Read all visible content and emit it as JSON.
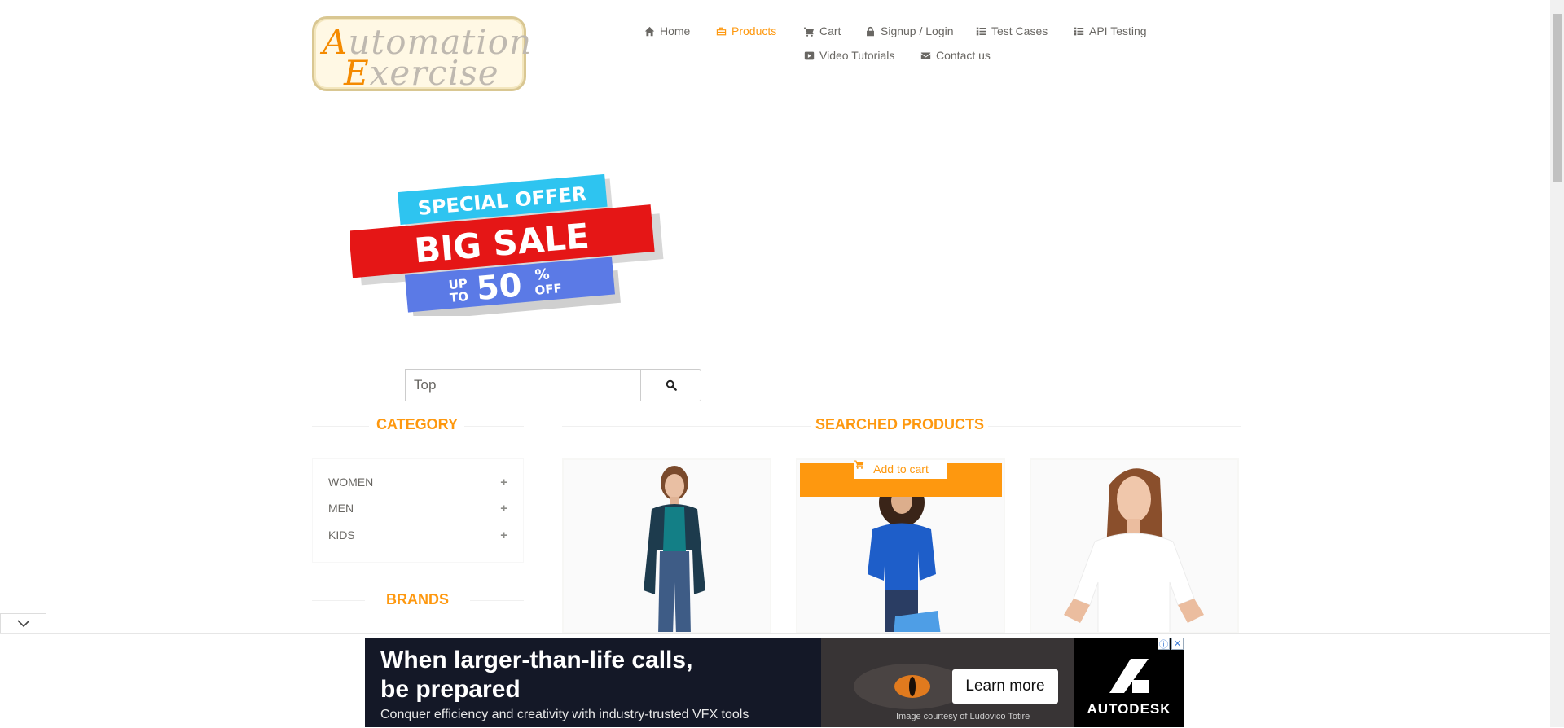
{
  "logo": {
    "line1_cap": "A",
    "line1_rest": "utomation",
    "line2_cap": "E",
    "line2_rest": "xercise"
  },
  "nav": {
    "items": [
      {
        "label": "Home",
        "icon": "home-icon"
      },
      {
        "label": "Products",
        "icon": "products-icon",
        "active": true
      },
      {
        "label": "Cart",
        "icon": "cart-icon"
      },
      {
        "label": "Signup / Login",
        "icon": "lock-icon"
      },
      {
        "label": "Test Cases",
        "icon": "list-icon"
      },
      {
        "label": "API Testing",
        "icon": "list-icon"
      },
      {
        "label": "Video Tutorials",
        "icon": "youtube-icon"
      },
      {
        "label": "Contact us",
        "icon": "envelope-icon"
      }
    ]
  },
  "banner": {
    "line1": "SPECIAL OFFER",
    "line2": "BIG SALE",
    "line3_up": "UP",
    "line3_to": "TO",
    "line3_pct": "50",
    "line3_sym": "%",
    "line3_off": "OFF"
  },
  "search": {
    "value": "Top"
  },
  "sidebar": {
    "category_title": "CATEGORY",
    "categories": [
      {
        "label": "WOMEN",
        "toggle": "+"
      },
      {
        "label": "MEN",
        "toggle": "+"
      },
      {
        "label": "KIDS",
        "toggle": "+"
      }
    ],
    "brands_title": "BRANDS"
  },
  "products": {
    "title": "SEARCHED PRODUCTS",
    "add_to_cart_label": "Add to cart"
  },
  "ad": {
    "headline_line1": "When larger-than-life calls,",
    "headline_line2": "be prepared",
    "sub": "Conquer efficiency and creativity with industry-trusted VFX tools",
    "credit": "Image courtesy of Ludovico Totire",
    "cta": "Learn more",
    "brand": "AUTODESK",
    "info_glyph": "ⓘ",
    "close_glyph": "✕"
  },
  "colors": {
    "accent": "#fe980f",
    "text": "#696763"
  }
}
